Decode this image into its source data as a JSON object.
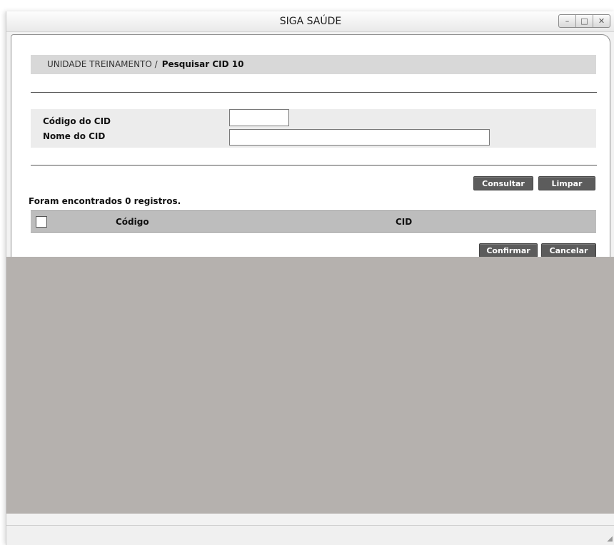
{
  "window": {
    "title": "SIGA SAÚDE",
    "minimize_glyph": "–",
    "maximize_glyph": "□",
    "close_glyph": "✕"
  },
  "breadcrumb": {
    "unit": "UNIDADE TREINAMENTO /",
    "page": "Pesquisar CID 10"
  },
  "form": {
    "codigo_label": "Código do CID",
    "codigo_value": "",
    "nome_label": "Nome do CID",
    "nome_value": ""
  },
  "actions": {
    "consultar": "Consultar",
    "limpar": "Limpar",
    "confirmar": "Confirmar",
    "cancelar": "Cancelar"
  },
  "results": {
    "count_text": "Foram encontrados 0 registros.",
    "columns": [
      "Código",
      "CID"
    ],
    "rows": []
  }
}
